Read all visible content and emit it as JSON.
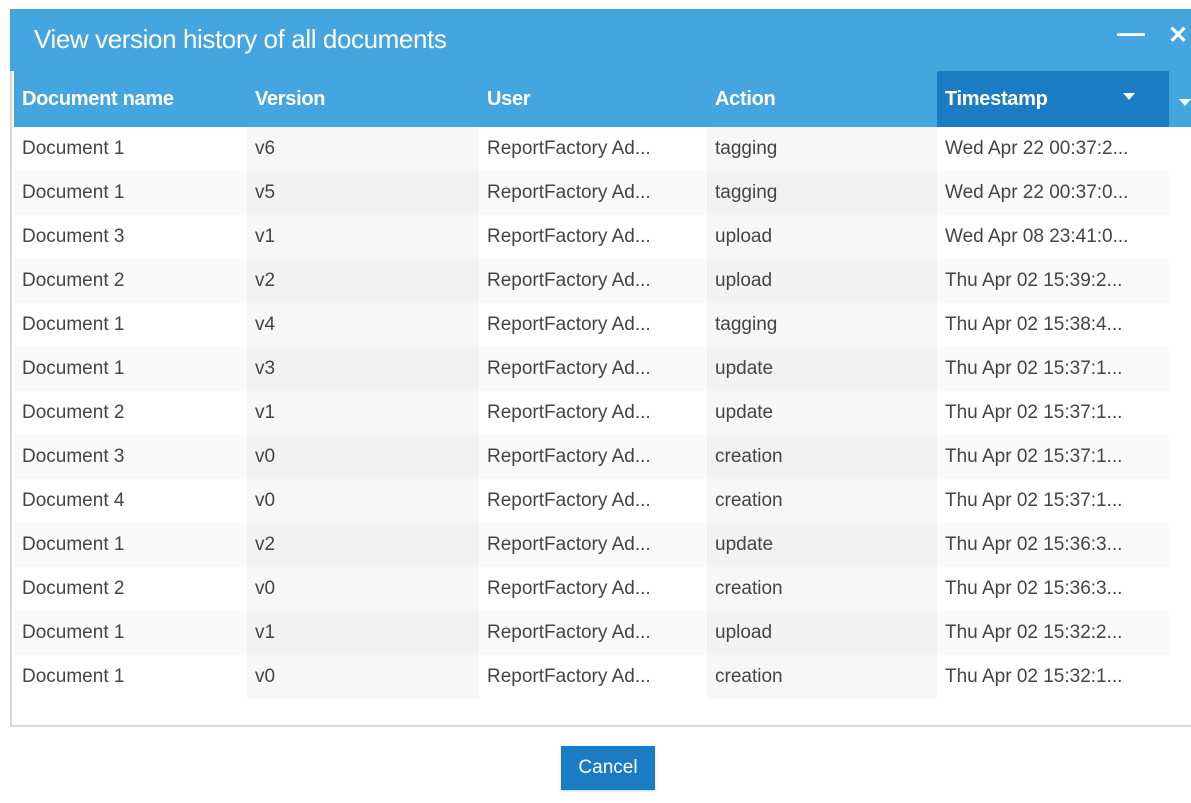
{
  "dialog": {
    "title": "View version history of all documents",
    "minimize_glyph": "—",
    "close_glyph": "✕",
    "cancel_label": "Cancel"
  },
  "table": {
    "columns": [
      "Document name",
      "Version",
      "User",
      "Action",
      "Timestamp"
    ],
    "sorted_column": "Timestamp",
    "rows": [
      [
        "Document 1",
        "v6",
        "ReportFactory Ad...",
        "tagging",
        "Wed Apr 22 00:37:2..."
      ],
      [
        "Document 1",
        "v5",
        "ReportFactory Ad...",
        "tagging",
        "Wed Apr 22 00:37:0..."
      ],
      [
        "Document 3",
        "v1",
        "ReportFactory Ad...",
        "upload",
        "Wed Apr 08 23:41:0..."
      ],
      [
        "Document 2",
        "v2",
        "ReportFactory Ad...",
        "upload",
        "Thu Apr 02 15:39:2..."
      ],
      [
        "Document 1",
        "v4",
        "ReportFactory Ad...",
        "tagging",
        "Thu Apr 02 15:38:4..."
      ],
      [
        "Document 1",
        "v3",
        "ReportFactory Ad...",
        "update",
        "Thu Apr 02 15:37:1..."
      ],
      [
        "Document 2",
        "v1",
        "ReportFactory Ad...",
        "update",
        "Thu Apr 02 15:37:1..."
      ],
      [
        "Document 3",
        "v0",
        "ReportFactory Ad...",
        "creation",
        "Thu Apr 02 15:37:1..."
      ],
      [
        "Document 4",
        "v0",
        "ReportFactory Ad...",
        "creation",
        "Thu Apr 02 15:37:1..."
      ],
      [
        "Document 1",
        "v2",
        "ReportFactory Ad...",
        "update",
        "Thu Apr 02 15:36:3..."
      ],
      [
        "Document 2",
        "v0",
        "ReportFactory Ad...",
        "creation",
        "Thu Apr 02 15:36:3..."
      ],
      [
        "Document 1",
        "v1",
        "ReportFactory Ad...",
        "upload",
        "Thu Apr 02 15:32:2..."
      ],
      [
        "Document 1",
        "v0",
        "ReportFactory Ad...",
        "creation",
        "Thu Apr 02 15:32:1..."
      ]
    ]
  },
  "colors": {
    "titlebar": "#45a5df",
    "header": "#45a5df",
    "sorted_header": "#1b7cc4",
    "button": "#1b7cc4"
  },
  "icons": [
    "minimize-icon",
    "close-icon",
    "sort-desc-icon",
    "column-menu-icon"
  ]
}
